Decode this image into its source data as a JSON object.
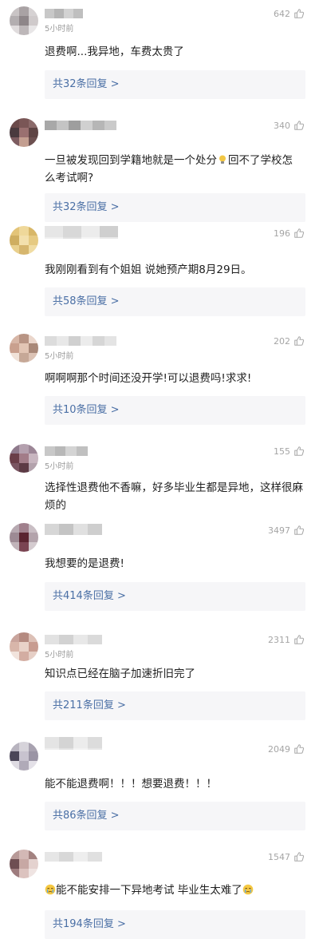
{
  "comments": [
    {
      "time": "5小时前",
      "likes": "642",
      "text": "退费啊...我异地，车费太贵了",
      "replies": "共32条回复 >"
    },
    {
      "time": "",
      "likes": "340",
      "text_before": "一旦被发现回到学籍地就是一个处分",
      "text_after": "回不了学校怎么考试啊?",
      "replies": "共32条回复 >"
    },
    {
      "time": "",
      "likes": "196",
      "text": "我刚刚看到有个姐姐  说她预产期8月29日。",
      "replies": "共58条回复 >"
    },
    {
      "time": "5小时前",
      "likes": "202",
      "text": "啊啊啊那个时间还没开学!可以退费吗!求求!",
      "replies": "共10条回复 >"
    },
    {
      "time": "5小时前",
      "likes": "155",
      "text": "选择性退费他不香嘛，好多毕业生都是异地，这样很麻烦的",
      "replies": ""
    },
    {
      "time": "",
      "likes": "3497",
      "text": "我想要的是退费!",
      "replies": "共414条回复 >"
    },
    {
      "time": "5小时前",
      "likes": "2311",
      "text": "知识点已经在脑子加速折旧完了",
      "replies": "共211条回复 >"
    },
    {
      "time": "",
      "likes": "2049",
      "text": "能不能退费啊！！！想要退费！！！",
      "replies": "共86条回复 >"
    },
    {
      "time": "",
      "likes": "1547",
      "text_mid": "能不能安排一下异地考试  毕业生太难了",
      "replies": "共194条回复 >"
    }
  ],
  "icons": {
    "like": "thumbs-up-icon",
    "emoji_lightbulb": "lightbulb-emoji",
    "emoji_cry": "crying-emoji"
  },
  "colors": {
    "reply_text": "#4a6fa5",
    "reply_bg": "#f6f6f8",
    "count": "#a5a5a5"
  }
}
